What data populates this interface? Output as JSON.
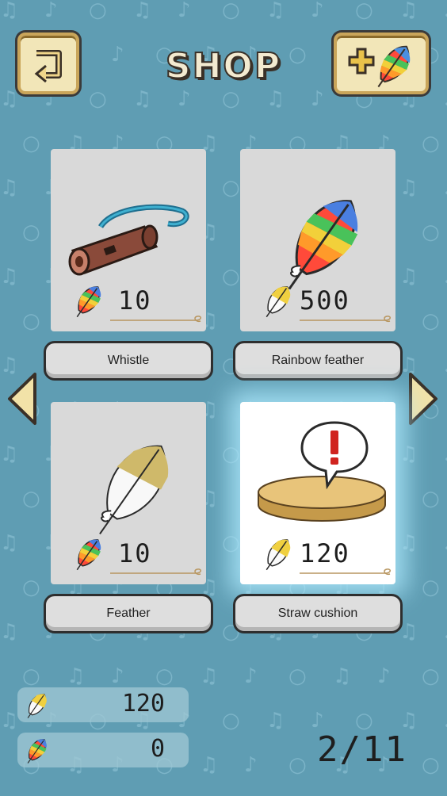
{
  "header": {
    "title": "SHOP"
  },
  "items": [
    {
      "name": "Whistle",
      "price": "10",
      "currency": "rainbow-feather",
      "selected": false
    },
    {
      "name": "Rainbow feather",
      "price": "500",
      "currency": "yellow-feather",
      "selected": false
    },
    {
      "name": "Feather",
      "price": "10",
      "currency": "rainbow-feather",
      "selected": false
    },
    {
      "name": "Straw cushion",
      "price": "120",
      "currency": "yellow-feather",
      "selected": true
    }
  ],
  "balances": {
    "yellow_feathers": "120",
    "rainbow_feathers": "0"
  },
  "pagination": {
    "indicator": "2/11"
  },
  "colors": {
    "background": "#5f9db3",
    "button_frame": "#c9a55a",
    "card": "#d9d9d9",
    "alert_red": "#d0231f"
  }
}
